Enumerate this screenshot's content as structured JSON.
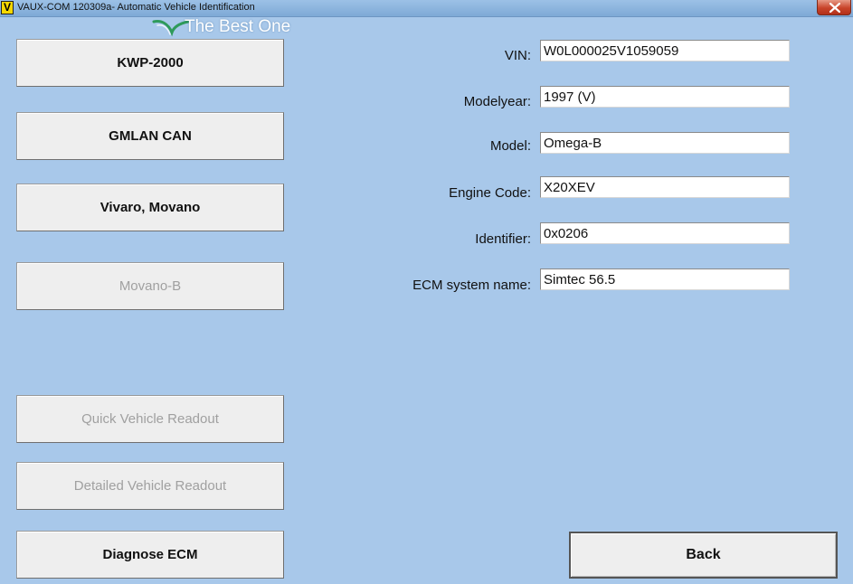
{
  "window": {
    "app_icon_letter": "V",
    "title": "VAUX-COM 120309a- Automatic Vehicle Identification"
  },
  "watermark": {
    "text": "The Best One",
    "color": "#2e9a5a"
  },
  "protocol_buttons": [
    {
      "label": "KWP-2000",
      "enabled": true
    },
    {
      "label": "GMLAN CAN",
      "enabled": true
    },
    {
      "label": "Vivaro, Movano",
      "enabled": true
    },
    {
      "label": "Movano-B",
      "enabled": false
    }
  ],
  "action_buttons": [
    {
      "label": "Quick Vehicle Readout",
      "enabled": false
    },
    {
      "label": "Detailed Vehicle Readout",
      "enabled": false
    },
    {
      "label": "Diagnose ECM",
      "enabled": true
    }
  ],
  "fields": [
    {
      "label": "VIN:",
      "value": "W0L000025V1059059"
    },
    {
      "label": "Modelyear:",
      "value": "1997 (V)"
    },
    {
      "label": "Model:",
      "value": "Omega-B"
    },
    {
      "label": "Engine Code:",
      "value": "X20XEV"
    },
    {
      "label": "Identifier:",
      "value": "0x0206"
    },
    {
      "label": "ECM system name:",
      "value": "Simtec 56.5"
    }
  ],
  "back_button": {
    "label": "Back"
  },
  "colors": {
    "background": "#a8c8ea",
    "button_face": "#eeeeee",
    "disabled_text": "#a0a0a0",
    "close_button": "#c8442a"
  }
}
